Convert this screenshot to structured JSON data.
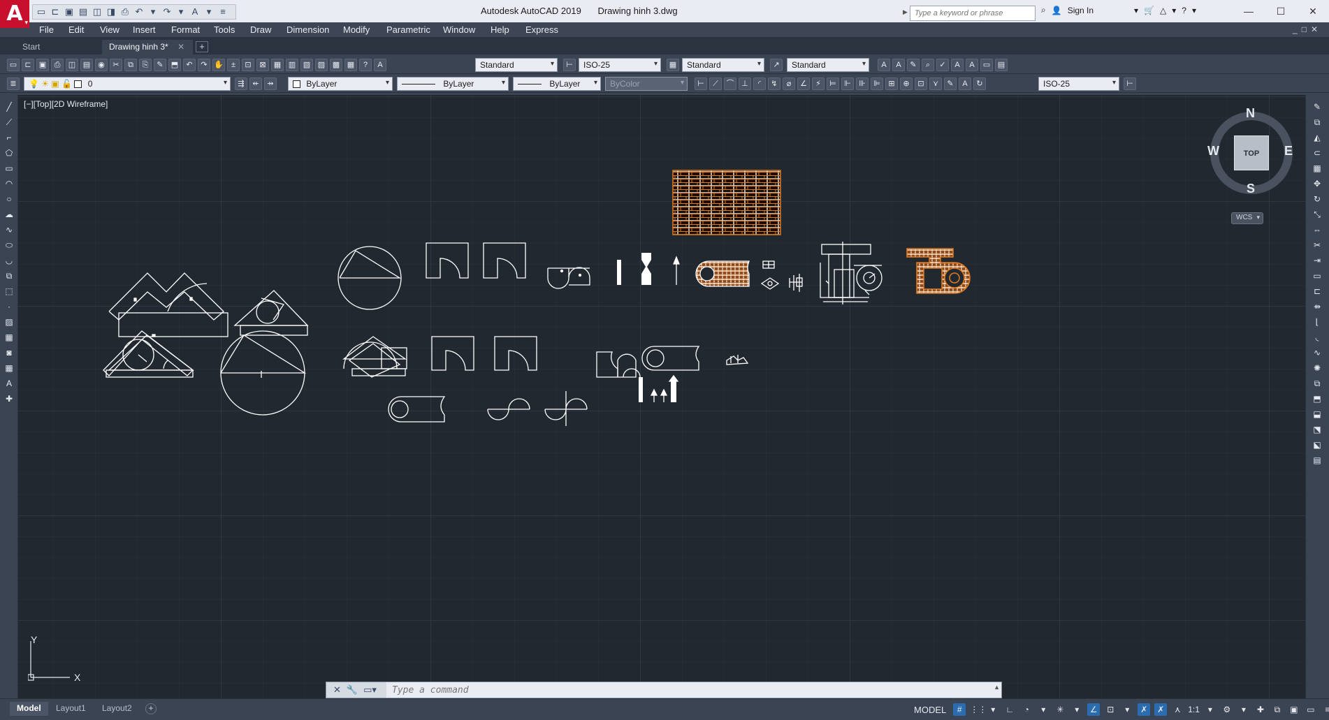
{
  "window": {
    "app_name": "Autodesk AutoCAD 2019",
    "document_name": "Drawing hinh 3.dwg",
    "logo_letter": "A",
    "search_placeholder": "Type a keyword or phrase",
    "sign_in": "Sign In",
    "controls": [
      "—",
      "☐",
      "✕"
    ]
  },
  "menu": [
    "File",
    "Edit",
    "View",
    "Insert",
    "Format",
    "Tools",
    "Draw",
    "Dimension",
    "Modify",
    "Parametric",
    "Window",
    "Help",
    "Express"
  ],
  "tabs": [
    {
      "label": "Start",
      "active": false
    },
    {
      "label": "Drawing hinh 3*",
      "active": true
    }
  ],
  "tab_add": "+",
  "toolbar": {
    "text_style": "Standard",
    "dim_style": "ISO-25",
    "table_style": "Standard",
    "multileader_style": "Standard",
    "layer": "0",
    "color": "ByLayer",
    "linetype": "ByLayer",
    "lineweight": "ByLayer",
    "plot_style": "ByColor",
    "dim_style_2": "ISO-25"
  },
  "viewport": {
    "label": "[−][Top][2D Wireframe]",
    "viewcube": {
      "face": "TOP",
      "north": "N",
      "south": "S",
      "east": "E",
      "west": "W"
    },
    "ucs_menu": "WCS",
    "ucs_axes": {
      "x": "X",
      "y": "Y"
    }
  },
  "command": {
    "placeholder": "Type a command"
  },
  "layout_tabs": [
    {
      "label": "Model",
      "active": true
    },
    {
      "label": "Layout1",
      "active": false
    },
    {
      "label": "Layout2",
      "active": false
    }
  ],
  "layout_add": "+",
  "status": {
    "space": "MODEL",
    "scale": "1:1"
  },
  "colors": {
    "canvas_bg": "#212830",
    "ui_bg": "#3b4453",
    "linework": "#ffffff",
    "hatch_brick": "#e07a1f",
    "hatch_wood": "#a0521a",
    "accent_blue": "#2a6cb0",
    "logo_red": "#c8102e"
  }
}
